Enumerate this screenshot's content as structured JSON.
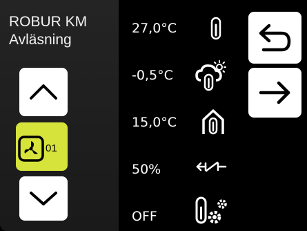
{
  "header": {
    "line1": "ROBUR KM",
    "line2": "Avläsning"
  },
  "fan": {
    "number": "01"
  },
  "readings": [
    {
      "value": "27,0°C",
      "icon": "thermometer-icon"
    },
    {
      "value": "-0,5°C",
      "icon": "outdoor-weather-thermometer-icon"
    },
    {
      "value": "15,0°C",
      "icon": "indoor-house-thermometer-icon"
    },
    {
      "value": "50%",
      "icon": "damper-valve-icon"
    },
    {
      "value": "OFF",
      "icon": "heating-settings-icon"
    }
  ],
  "icons": {
    "up": "chevron-up-icon",
    "down": "chevron-down-icon",
    "fan": "fan-icon",
    "back": "back-arrow-icon",
    "next": "right-arrow-icon"
  },
  "colors": {
    "accent": "#d6e33a",
    "background": "#000000",
    "panel": "#1f1f1f"
  }
}
